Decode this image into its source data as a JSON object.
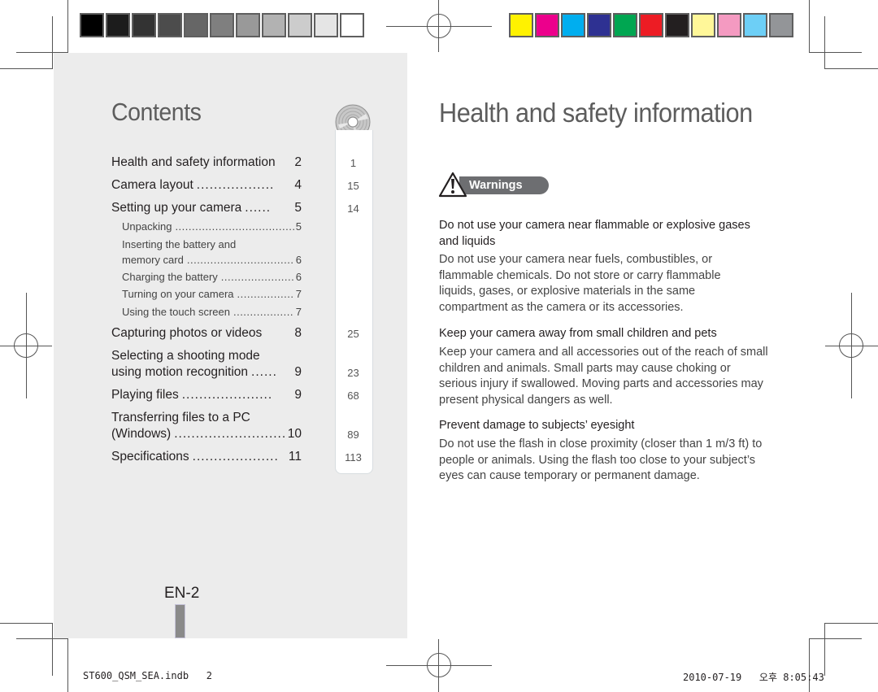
{
  "color_bars": {
    "grayscale": [
      "#000000",
      "#1c1c1c",
      "#333333",
      "#4c4c4c",
      "#666666",
      "#7f7f7f",
      "#999999",
      "#b2b2b2",
      "#cccccc",
      "#e5e5e5",
      "#ffffff"
    ],
    "process": [
      "#fff200",
      "#ec008c",
      "#00aeef",
      "#2e3192",
      "#00a651",
      "#ed1c24",
      "#231f20",
      "#fff799",
      "#f49ac1",
      "#6dcff6",
      "#939598"
    ]
  },
  "left_page": {
    "title": "Contents",
    "toc": [
      {
        "label": "Health and safety information",
        "dots": "",
        "page": "2",
        "tab": "1"
      },
      {
        "label": "Camera layout",
        "dots": "..................",
        "page": "4",
        "tab": "15"
      },
      {
        "label": "Setting up your camera",
        "dots": "......",
        "page": "5",
        "tab": "14"
      },
      {
        "label": "Capturing photos or videos",
        "dots": "",
        "page": "8",
        "tab": "25"
      },
      {
        "label_line1": "Selecting a shooting mode",
        "label": "using motion recognition",
        "dots": "......",
        "page": "9",
        "tab": "23"
      },
      {
        "label": "Playing files",
        "dots": ".....................",
        "page": "9",
        "tab": "68"
      },
      {
        "label_line1": "Transferring files to a PC",
        "label": "(Windows)",
        "dots": "..............................",
        "page": "10",
        "tab": "89"
      },
      {
        "label": "Specifications",
        "dots": "....................",
        "page": "11",
        "tab": "113"
      }
    ],
    "subitems": [
      {
        "label": "Unpacking",
        "dots": "...................................................",
        "page": "5"
      },
      {
        "label_line1": "Inserting the battery and",
        "label": "memory card",
        "dots": "...................................................",
        "page": "6"
      },
      {
        "label": "Charging the battery",
        "dots": "...................................................",
        "page": "6"
      },
      {
        "label": "Turning on your camera",
        "dots": "...................................................",
        "page": "7"
      },
      {
        "label": "Using the touch screen",
        "dots": "...................................................",
        "page": "7"
      }
    ],
    "page_label": "EN-2"
  },
  "right_page": {
    "title": "Health and safety information",
    "badge": "Warnings",
    "sections": [
      {
        "heading": "Do not use your camera near flammable or explosive gases and liquids",
        "body": "Do not use your camera near fuels, combustibles, or flammable chemicals. Do not store or carry flammable liquids, gases, or explosive materials in the same compartment as the camera or its accessories."
      },
      {
        "heading": "Keep your camera away from small children and pets",
        "body": "Keep your camera and all accessories out of the reach of small children and animals. Small parts may cause choking or serious injury if swallowed. Moving parts and accessories may present physical dangers as well."
      },
      {
        "heading": "Prevent damage to subjects’ eyesight",
        "body": "Do not use the flash in close proximity (closer than 1 m/3 ft) to people or animals. Using the flash too close to your subject’s eyes can cause temporary or permanent damage."
      }
    ]
  },
  "footer": {
    "file": "ST600_QSM_SEA.indb   2",
    "timestamp": "2010-07-19   오후 8:05:43"
  }
}
